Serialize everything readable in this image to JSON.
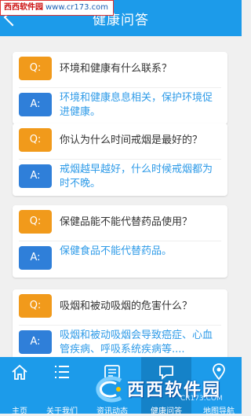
{
  "header": {
    "title": "健康问答"
  },
  "watermark": {
    "text": "西西软件园",
    "site": "www.cr173.com"
  },
  "badges": {
    "q": "Q:",
    "a": "A:"
  },
  "qa": [
    {
      "question": "环境和健康有什么联系？",
      "answer": "环境和健康息息相关，保护环境促进健康。"
    },
    {
      "question": "你认为什么时间戒烟是最好的？",
      "answer": "戒烟越早越好，什么时候戒烟都为时不晚。"
    },
    {
      "question": "保健品能不能代替药品使用？",
      "answer": "保健食品不能代替药品。"
    },
    {
      "question": "吸烟和被动吸烟的危害什么？",
      "answer": "吸烟和被动吸烟会导致癌症、心血管疾病、呼吸系统疾病等...."
    }
  ],
  "tabs": [
    {
      "label": "主页",
      "icon": "home-icon"
    },
    {
      "label": "关于我们",
      "icon": "list-icon"
    },
    {
      "label": "资讯动态",
      "icon": "news-icon"
    },
    {
      "label": "健康问答",
      "icon": "qa-icon",
      "active": true
    },
    {
      "label": "地图导航",
      "icon": "map-icon"
    }
  ],
  "logo": {
    "text": "西西软件园",
    "sub": "CR173.COM"
  },
  "colors": {
    "brand": "#1c9bea",
    "q_badge": "#f19a1b",
    "a_badge": "#2f7fd9",
    "answer_text": "#2f9be8"
  }
}
